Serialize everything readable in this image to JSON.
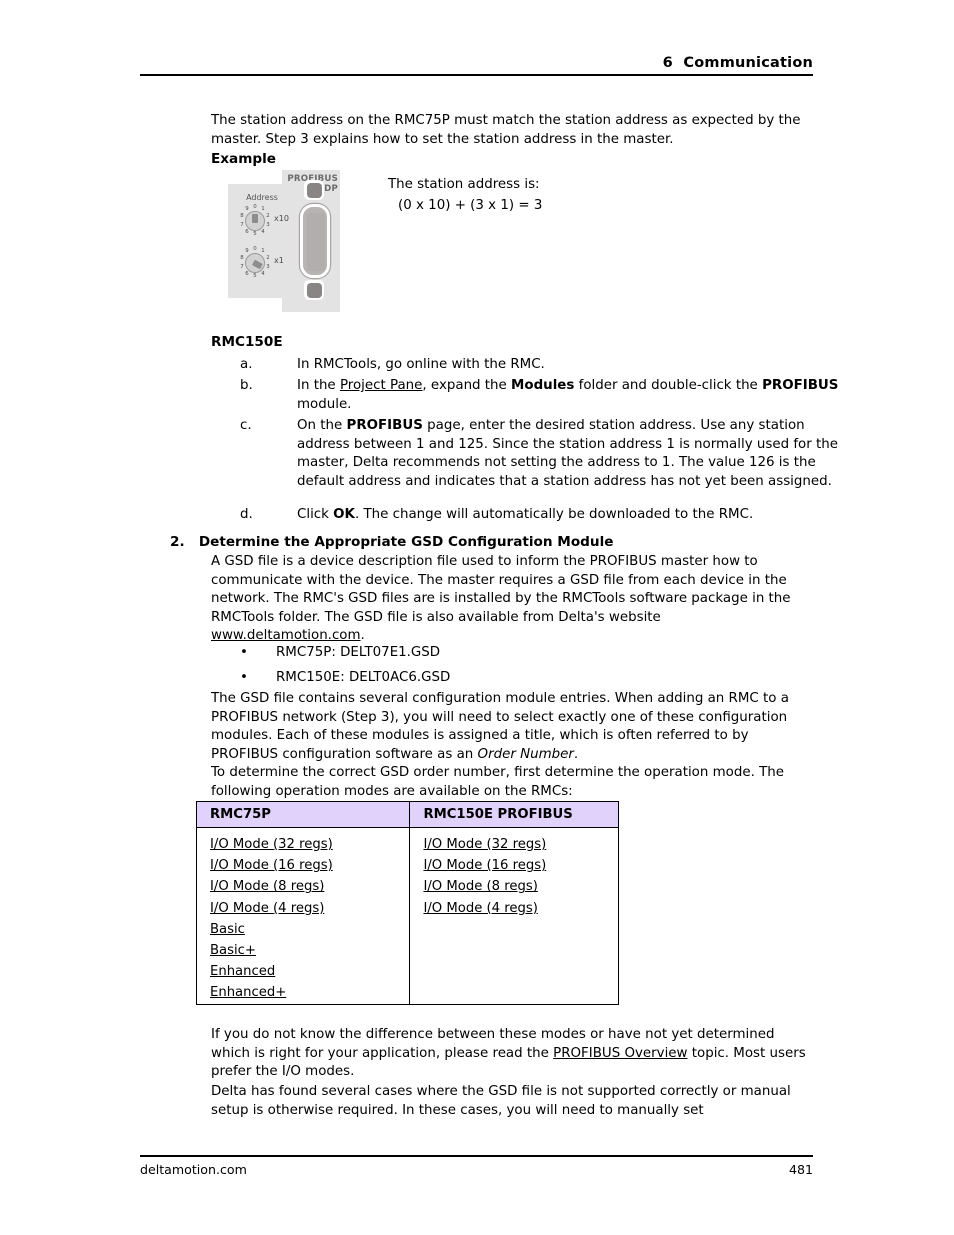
{
  "header": {
    "chapter_number": "6",
    "chapter_title": "Communication",
    "running_head": "6  Communication"
  },
  "intro": {
    "paragraph": "The station address on the RMC75P must match the station address as expected by the master. Step 3 explains how to set the station address in the master.",
    "example_label": "Example"
  },
  "figure": {
    "label_profibus_line1": "PROFIBUS",
    "label_profibus_line2": "DP",
    "label_address": "Address",
    "switch_x10_multiplier": "x10",
    "switch_x1_multiplier": "x1",
    "switch_digits": [
      "0",
      "1",
      "2",
      "3",
      "4",
      "5",
      "6",
      "7",
      "8",
      "9"
    ],
    "caption_line1": "The station address is:",
    "caption_line2": "(0 x 10) + (3 x 1) = 3"
  },
  "rmc150e": {
    "heading": "RMC150E",
    "items": [
      {
        "marker": "a.",
        "text_parts": [
          {
            "text": "In RMCTools, go online with the RMC.",
            "style": "normal"
          }
        ]
      },
      {
        "marker": "b.",
        "text_parts": [
          {
            "text": "In the ",
            "style": "normal"
          },
          {
            "text": "Project Pane",
            "style": "underline"
          },
          {
            "text": ", expand the ",
            "style": "normal"
          },
          {
            "text": "Modules",
            "style": "bold"
          },
          {
            "text": " folder and double-click the ",
            "style": "normal"
          },
          {
            "text": "PROFIBUS",
            "style": "bold"
          },
          {
            "text": " module.",
            "style": "normal"
          }
        ]
      },
      {
        "marker": "c.",
        "text_parts": [
          {
            "text": "On the ",
            "style": "normal"
          },
          {
            "text": "PROFIBUS",
            "style": "bold"
          },
          {
            "text": " page, enter the desired station address. Use any station address between 1 and 125. Since the station address 1 is normally used for the master, Delta recommends not setting the address to 1. The value 126 is the default address and indicates that a station address has not yet been assigned.",
            "style": "normal"
          }
        ]
      },
      {
        "marker": "d.",
        "text_parts": [
          {
            "text": "Click ",
            "style": "normal"
          },
          {
            "text": "OK",
            "style": "bold"
          },
          {
            "text": ". The change will automatically be downloaded to the RMC.",
            "style": "normal"
          }
        ]
      }
    ]
  },
  "step2": {
    "number": "2.",
    "heading": "Determine the Appropriate GSD Configuration Module",
    "paragraph1_parts": [
      {
        "text": "A GSD file is a device description file used to inform the PROFIBUS master how to communicate with the device. The master requires a GSD file from each device in the network. The RMC's GSD files are is installed by the RMCTools software package in the RMCTools folder. The GSD file is also available from Delta's website ",
        "style": "normal"
      },
      {
        "text": "www.deltamotion.com",
        "style": "link"
      },
      {
        "text": ".",
        "style": "normal"
      }
    ],
    "gsd_files": [
      "RMC75P: DELT07E1.GSD",
      "RMC150E: DELT0AC6.GSD"
    ],
    "paragraph2_parts": [
      {
        "text": "The GSD file contains several configuration module entries. When adding an RMC to a PROFIBUS network (Step 3), you will need to select exactly one of these configuration modules. Each of these modules is assigned a title, which is often referred to by PROFIBUS configuration software as an ",
        "style": "normal"
      },
      {
        "text": "Order Number",
        "style": "italic"
      },
      {
        "text": ".",
        "style": "normal"
      }
    ],
    "paragraph3": "To determine the correct GSD order number, first determine the operation mode. The following operation modes are available on the RMCs:",
    "paragraph4_parts": [
      {
        "text": "If you do not know the difference between these modes or have not yet determined which is right for your application, please read the ",
        "style": "normal"
      },
      {
        "text": "PROFIBUS Overview",
        "style": "link"
      },
      {
        "text": " topic. Most users prefer the I/O modes.",
        "style": "normal"
      }
    ],
    "paragraph5": "Delta has found several cases where the GSD file is not supported correctly or manual setup is otherwise required. In these cases, you will need to manually set"
  },
  "modes_table": {
    "header_background": "#e0d2fa",
    "columns": [
      "RMC75P",
      "RMC150E PROFIBUS"
    ],
    "rmc75p_modes": [
      "I/O Mode (32 regs)",
      "I/O Mode (16 regs)",
      "I/O Mode (8 regs)",
      "I/O Mode (4 regs)",
      "Basic",
      "Basic+",
      "Enhanced",
      "Enhanced+"
    ],
    "rmc150e_modes": [
      "I/O Mode (32 regs)",
      "I/O Mode (16 regs)",
      "I/O Mode (8 regs)",
      "I/O Mode (4 regs)"
    ]
  },
  "footer": {
    "site": "deltamotion.com",
    "page_number": "481"
  }
}
